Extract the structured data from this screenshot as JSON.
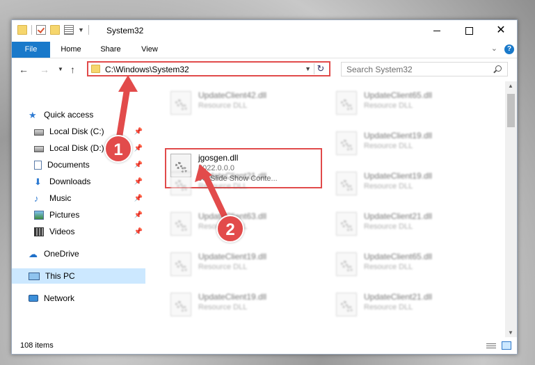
{
  "window": {
    "title": "System32",
    "controls": {
      "minimize": "minimize",
      "maximize": "maximize",
      "close": "✕"
    }
  },
  "ribbon": {
    "tabs": [
      "File",
      "Home",
      "Share",
      "View"
    ],
    "expand_glyph": "⌄",
    "help_glyph": "?"
  },
  "navbar": {
    "back_glyph": "←",
    "forward_glyph": "→",
    "recent_glyph": "▼",
    "up_glyph": "↑",
    "address": "C:\\Windows\\System32",
    "address_drop_glyph": "▼",
    "refresh_glyph": "↻",
    "search_placeholder": "Search System32"
  },
  "sidebar": {
    "items": [
      {
        "label": "Quick access",
        "icon": "star-icon",
        "pinned": false
      },
      {
        "label": "Local Disk (C:)",
        "icon": "disk-icon",
        "pinned": true
      },
      {
        "label": "Local Disk (D:)",
        "icon": "disk-icon",
        "pinned": true
      },
      {
        "label": "Documents",
        "icon": "documents-icon",
        "pinned": true
      },
      {
        "label": "Downloads",
        "icon": "downloads-icon",
        "pinned": true
      },
      {
        "label": "Music",
        "icon": "music-icon",
        "pinned": true
      },
      {
        "label": "Pictures",
        "icon": "pictures-icon",
        "pinned": true
      },
      {
        "label": "Videos",
        "icon": "videos-icon",
        "pinned": true
      },
      {
        "label": "OneDrive",
        "icon": "onedrive-icon",
        "pinned": false
      },
      {
        "label": "This PC",
        "icon": "this-pc-icon",
        "pinned": false,
        "selected": true
      },
      {
        "label": "Network",
        "icon": "network-icon",
        "pinned": false
      }
    ],
    "pin_glyph": "📌"
  },
  "files": [
    {
      "name": "UpdateClient42.dll",
      "type": "Resource DLL",
      "col": 0,
      "row": 0
    },
    {
      "name": "UpdateClient65.dll",
      "type": "Resource DLL",
      "col": 1,
      "row": 0
    },
    {
      "name": "jgosgen.dll",
      "version": "5022.0.0.0",
      "description": "JG Slide Show Conte...",
      "col": 0,
      "row": 1,
      "highlighted": true
    },
    {
      "name": "UpdateClient19.dll",
      "type": "Resource DLL",
      "col": 1,
      "row": 1
    },
    {
      "name": "UpdateClient21.dll",
      "type": "Resource DLL",
      "col": 0,
      "row": 2
    },
    {
      "name": "UpdateClient19.dll",
      "type": "Resource DLL",
      "col": 1,
      "row": 2
    },
    {
      "name": "UpdateClient63.dll",
      "type": "Resource DLL",
      "col": 0,
      "row": 3
    },
    {
      "name": "UpdateClient21.dll",
      "type": "Resource DLL",
      "col": 1,
      "row": 3
    },
    {
      "name": "UpdateClient19.dll",
      "type": "Resource DLL",
      "col": 0,
      "row": 4
    },
    {
      "name": "UpdateClient65.dll",
      "type": "Resource DLL",
      "col": 1,
      "row": 4
    },
    {
      "name": "UpdateClient19.dll",
      "type": "Resource DLL",
      "col": 0,
      "row": 5
    },
    {
      "name": "UpdateClient21.dll",
      "type": "Resource DLL",
      "col": 1,
      "row": 5
    }
  ],
  "scroll": {
    "up_glyph": "▲",
    "down_glyph": "▼"
  },
  "status": {
    "item_count": "108 items"
  },
  "annotations": {
    "callout_1": "1",
    "callout_2": "2"
  },
  "colors": {
    "accent": "#1979ca",
    "highlight_red": "#e14a4a",
    "selection": "#cce8ff"
  }
}
